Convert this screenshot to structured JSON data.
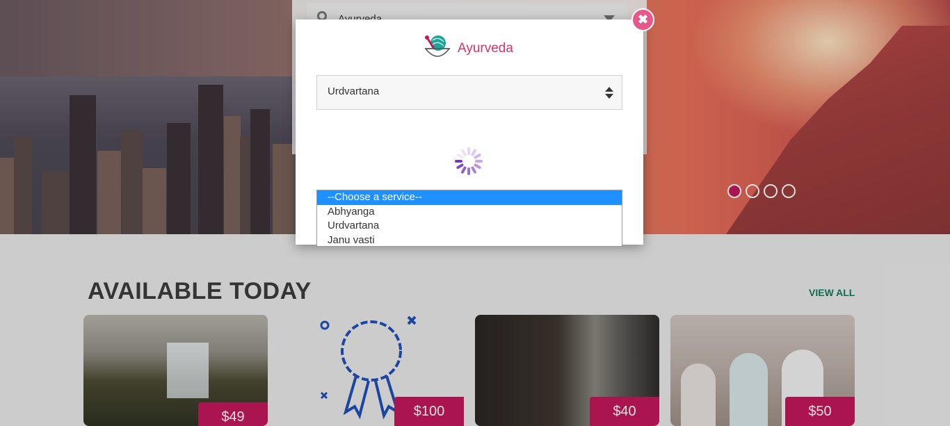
{
  "search": {
    "value": "Ayurveda"
  },
  "section": {
    "title": "AVAILABLE TODAY",
    "view_all": "VIEW ALL"
  },
  "cards": [
    {
      "price": "$49"
    },
    {
      "price": "$100"
    },
    {
      "price": "$40"
    },
    {
      "price": "$50"
    }
  ],
  "modal": {
    "brand": "Ayurveda",
    "close_symbol": "✖",
    "selected_category": "Urdvartana",
    "service_options": [
      "--Choose a service--",
      "Abhyanga",
      "Urdvartana",
      "Janu vasti"
    ],
    "selected_option_index": 0
  },
  "carousel": {
    "count": 4,
    "active_index": 0
  },
  "colors": {
    "accent": "#c2185b",
    "brand": "#d6336c",
    "link": "#137a5e",
    "highlight": "#1e90ff"
  }
}
